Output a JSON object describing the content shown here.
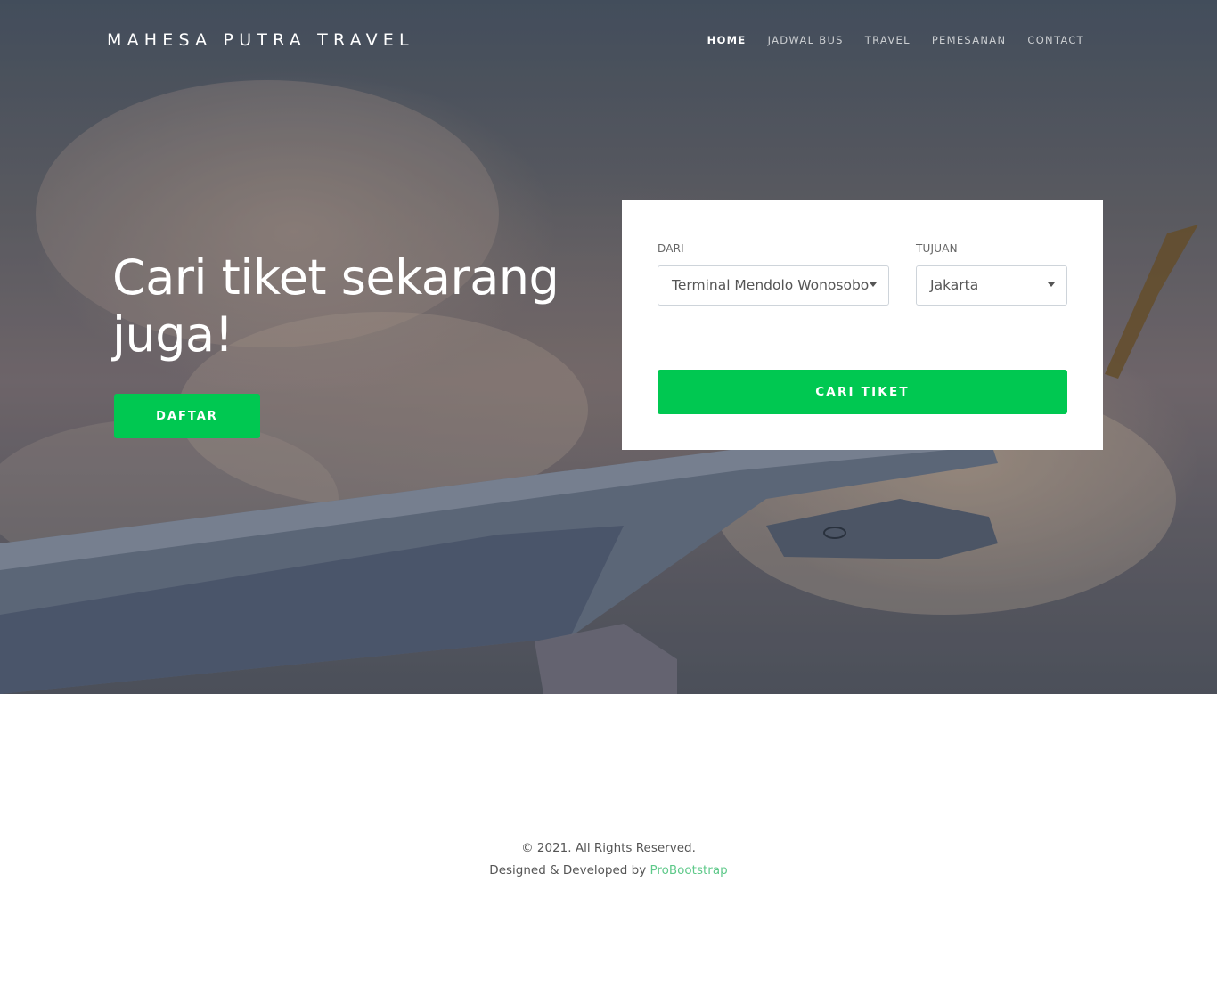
{
  "brand": {
    "name": "MAHESA PUTRA TRAVEL"
  },
  "nav": {
    "items": [
      {
        "label": "HOME",
        "active": true
      },
      {
        "label": "JADWAL BUS",
        "active": false
      },
      {
        "label": "TRAVEL",
        "active": false
      },
      {
        "label": "PEMESANAN",
        "active": false
      },
      {
        "label": "CONTACT",
        "active": false
      }
    ]
  },
  "hero": {
    "title": "Cari tiket sekarang juga!",
    "cta_label": "DAFTAR"
  },
  "search": {
    "from_label": "DARI",
    "from_value": "Terminal Mendolo Wonosobo",
    "to_label": "TUJUAN",
    "to_value": "Jakarta",
    "submit_label": "CARI TIKET"
  },
  "footer": {
    "copyright": "© 2021. All Rights Reserved.",
    "credit_prefix": "Designed & Developed by ",
    "credit_link": "ProBootstrap"
  },
  "colors": {
    "accent": "#00c851",
    "link": "#5fc98a"
  }
}
